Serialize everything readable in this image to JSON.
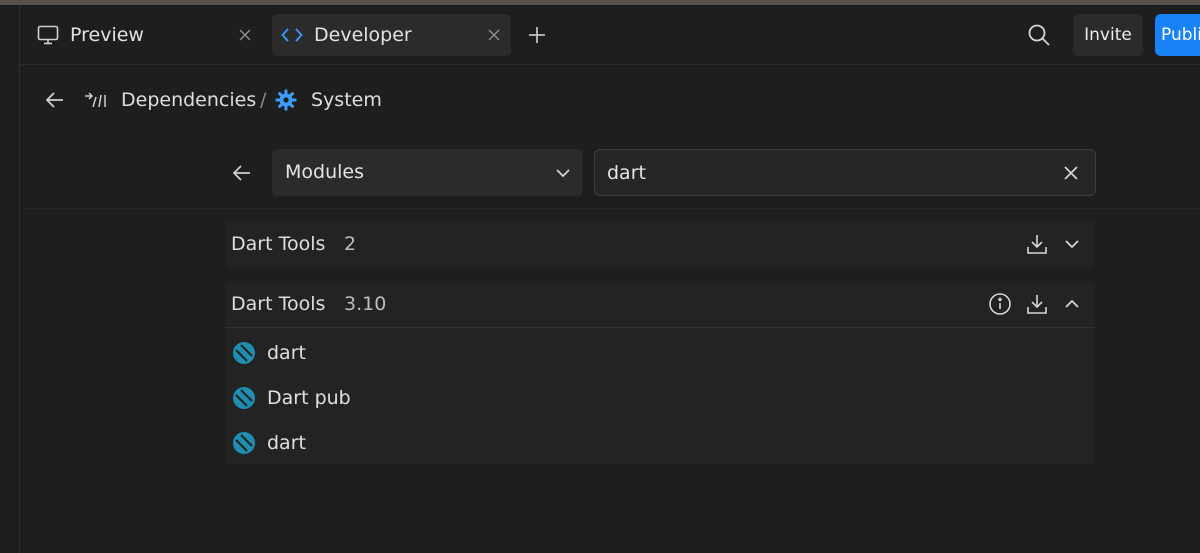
{
  "tabs": [
    {
      "label": "Preview",
      "icon": "monitor-icon"
    },
    {
      "label": "Developer",
      "icon": "code-icon",
      "active": true
    }
  ],
  "header": {
    "invite_label": "Invite",
    "publish_label": "Publish"
  },
  "breadcrumb": {
    "items": [
      {
        "label": "Dependencies",
        "icon": "dependencies-icon"
      },
      {
        "label": "System",
        "icon": "gear-icon"
      }
    ],
    "separator": "/"
  },
  "filter": {
    "select_value": "Modules",
    "search_value": "dart"
  },
  "groups": [
    {
      "name": "Dart Tools",
      "version": "2",
      "expanded": false,
      "items": []
    },
    {
      "name": "Dart Tools",
      "version": "3.10",
      "expanded": true,
      "items": [
        {
          "name": "dart"
        },
        {
          "name": "Dart pub"
        },
        {
          "name": "dart"
        }
      ]
    }
  ],
  "colors": {
    "accent": "#1a82f7",
    "background": "#1e1e1e",
    "panel": "#232323",
    "dart_icon": "#1e8fb0"
  }
}
